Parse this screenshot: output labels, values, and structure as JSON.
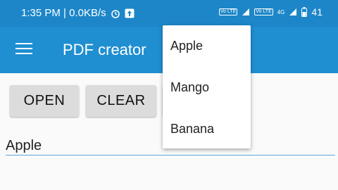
{
  "statusbar": {
    "time_speed": "1:35 PM | 0.0KB/s",
    "volte1": "Vo LTE",
    "volte2": "Vo LTE",
    "net_label": "4G",
    "battery": "41"
  },
  "appbar": {
    "title": "PDF creator"
  },
  "buttons": {
    "open": "OPEN",
    "clear": "CLEAR"
  },
  "field": {
    "value": "Apple"
  },
  "dropdown": {
    "options": [
      "Apple",
      "Mango",
      "Banana"
    ]
  }
}
